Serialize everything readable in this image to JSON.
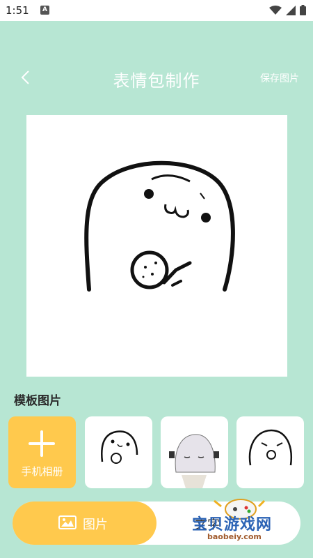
{
  "status_bar": {
    "time": "1:51",
    "notification_letter": "A"
  },
  "header": {
    "title": "表情包制作",
    "save_label": "保存图片"
  },
  "section": {
    "templates_title": "模板图片"
  },
  "templates": {
    "add_label": "手机相册"
  },
  "tabs": {
    "image_label": "图片",
    "text_label": "文字"
  },
  "watermark": {
    "text": "宝贝游戏网",
    "url": "baobeiy.com"
  },
  "colors": {
    "background": "#b7e6d3",
    "accent": "#ffc94d",
    "white": "#ffffff"
  }
}
